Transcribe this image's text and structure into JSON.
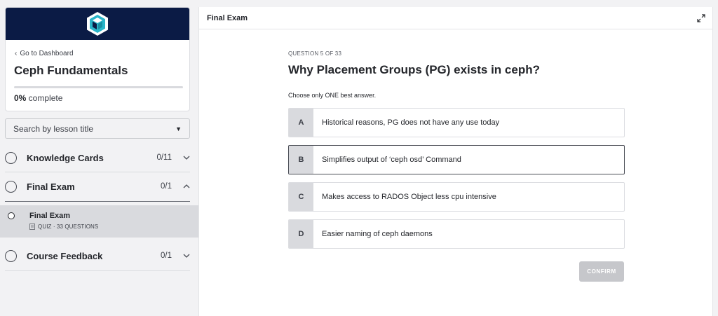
{
  "sidebar": {
    "back_link": "Go to Dashboard",
    "course_title": "Ceph Fundamentals",
    "progress": {
      "percent_label": "0%",
      "suffix": " complete",
      "fraction": 0
    },
    "search_placeholder": "Search by lesson title",
    "sections": [
      {
        "title": "Knowledge Cards",
        "count": "0/11",
        "expanded": false
      },
      {
        "title": "Final Exam",
        "count": "0/1",
        "expanded": true
      },
      {
        "title": "Course Feedback",
        "count": "0/1",
        "expanded": false
      }
    ],
    "active_lesson": {
      "title": "Final Exam",
      "meta": "QUIZ · 33 QUESTIONS"
    }
  },
  "main": {
    "header_title": "Final Exam",
    "question_counter": "QUESTION 5 OF 33",
    "question": "Why Placement Groups (PG) exists in ceph?",
    "instruction": "Choose only ONE best answer.",
    "options": [
      {
        "letter": "A",
        "text": "Historical reasons, PG does not have any use today"
      },
      {
        "letter": "B",
        "text": "Simplifies output of ‘ceph osd’  Command"
      },
      {
        "letter": "C",
        "text": "Makes access to RADOS Object less cpu intensive"
      },
      {
        "letter": "D",
        "text": "Easier naming of ceph daemons"
      }
    ],
    "confirm_label": "CONFIRM"
  },
  "colors": {
    "brand_navy": "#0b1b45",
    "logo_teal": "#29b5c9",
    "option_letter_bg": "#d9dade",
    "confirm_disabled": "#c6c7cb"
  },
  "icons": {
    "logo": "cube-logo-icon",
    "back": "chevron-left-icon",
    "caret": "caret-down-icon",
    "expand": "expand-arrows-icon",
    "quiz": "quiz-doc-icon"
  }
}
